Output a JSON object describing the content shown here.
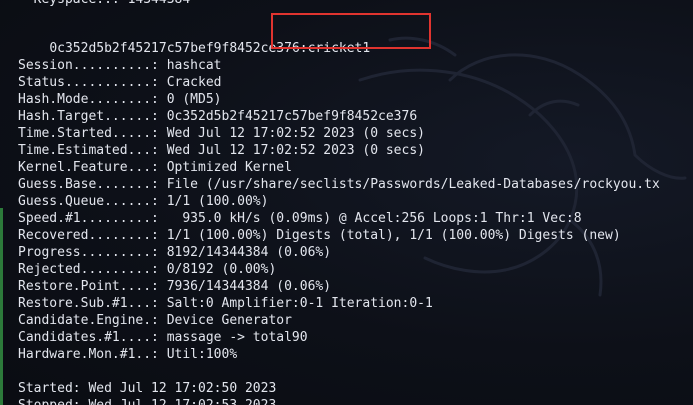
{
  "terminal": {
    "top_partial_line": "  Keyspace..: 14344384",
    "result_hash": "0c352d5b2f45217c57bef9f8452ce376",
    "result_password": "cricket1",
    "status_rows": [
      "Session..........: hashcat",
      "Status...........: Cracked",
      "Hash.Mode........: 0 (MD5)",
      "Hash.Target......: 0c352d5b2f45217c57bef9f8452ce376",
      "Time.Started.....: Wed Jul 12 17:02:52 2023 (0 secs)",
      "Time.Estimated...: Wed Jul 12 17:02:52 2023 (0 secs)",
      "Kernel.Feature...: Optimized Kernel",
      "Guess.Base.......: File (/usr/share/seclists/Passwords/Leaked-Databases/rockyou.tx",
      "Guess.Queue......: 1/1 (100.00%)",
      "Speed.#1.........:   935.0 kH/s (0.09ms) @ Accel:256 Loops:1 Thr:1 Vec:8",
      "Recovered........: 1/1 (100.00%) Digests (total), 1/1 (100.00%) Digests (new)",
      "Progress.........: 8192/14344384 (0.06%)",
      "Rejected.........: 0/8192 (0.00%)",
      "Restore.Point....: 7936/14344384 (0.06%)",
      "Restore.Sub.#1...: Salt:0 Amplifier:0-1 Iteration:0-1",
      "Candidate.Engine.: Device Generator",
      "Candidates.#1....: massage -> total90",
      "Hardware.Mon.#1..: Util:100%"
    ],
    "started_line": "Started: Wed Jul 12 17:02:50 2023",
    "stopped_line": "Stopped: Wed Jul 12 17:02:53 2023"
  },
  "colors": {
    "background": "#0b0d14",
    "text": "#e3e6ee",
    "highlight_border": "#e0342f"
  }
}
